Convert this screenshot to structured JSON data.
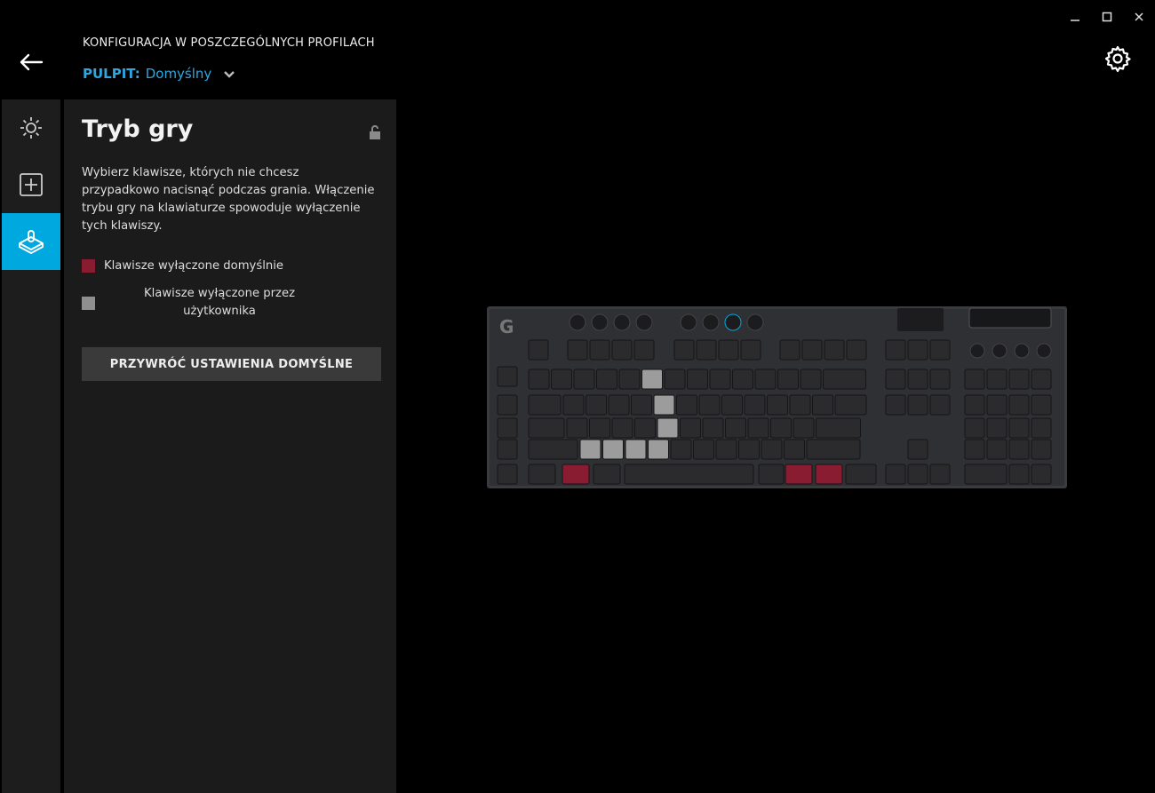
{
  "window": {
    "minimize_icon": "minimize-icon",
    "maximize_icon": "maximize-icon",
    "close_icon": "close-icon"
  },
  "header": {
    "title": "KONFIGURACJA W POSZCZEGÓLNYCH PROFILACH",
    "profile_label": "PULPIT:",
    "profile_value": "Domyślny"
  },
  "rail": {
    "items": [
      "lighting-icon",
      "assignments-icon",
      "game-mode-icon"
    ],
    "active": 2
  },
  "panel": {
    "title": "Tryb gry",
    "description": "Wybierz klawisze, których nie chcesz przypadkowo nacisnąć podczas grania. Włączenie trybu gry na klawiaturze spowoduje wyłączenie tych klawiszy.",
    "legend": [
      {
        "label": "Klawisze wyłączone domyślnie",
        "color": "#8a1c32"
      },
      {
        "label": "Klawisze wyłączone przez użytkownika",
        "color": "#8f8f8f"
      }
    ],
    "reset_button": "PRZYWRÓĆ USTAWIENIA DOMYŚLNE"
  },
  "keyboard": {
    "disabled_default_keys": [
      "Win-left",
      "Win-right",
      "Menu"
    ],
    "disabled_user_keys": [
      "5",
      "T",
      "G",
      "Z",
      "X",
      "C",
      "V"
    ],
    "colors": {
      "key": "#2b2b2d",
      "default_disabled": "#8a1c32",
      "user_disabled": "#9c9c9c",
      "accent": "#00a8e0"
    }
  }
}
